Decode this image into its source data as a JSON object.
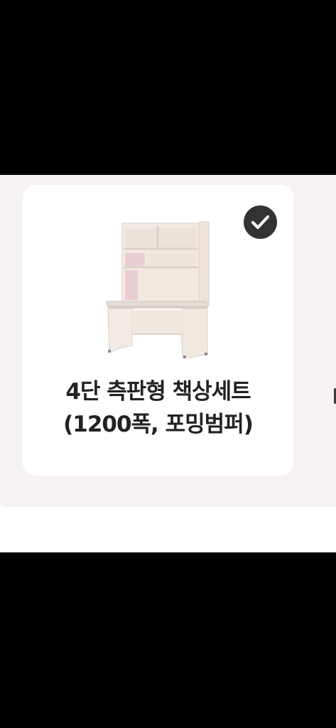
{
  "product_card": {
    "title_line1": "4단 측판형 책상세트",
    "title_line2": "(1200폭, 포밍범퍼)",
    "selected": true,
    "check_icon": "checkmark-icon",
    "image": "desk-with-hutch-image"
  },
  "colors": {
    "background_tint": "#f6f1f4",
    "card": "#ffffff",
    "check_badge": "#333333",
    "title_text": "#222222",
    "desk_body": "#f3ebe3",
    "desk_accent": "#e8cdd3"
  }
}
